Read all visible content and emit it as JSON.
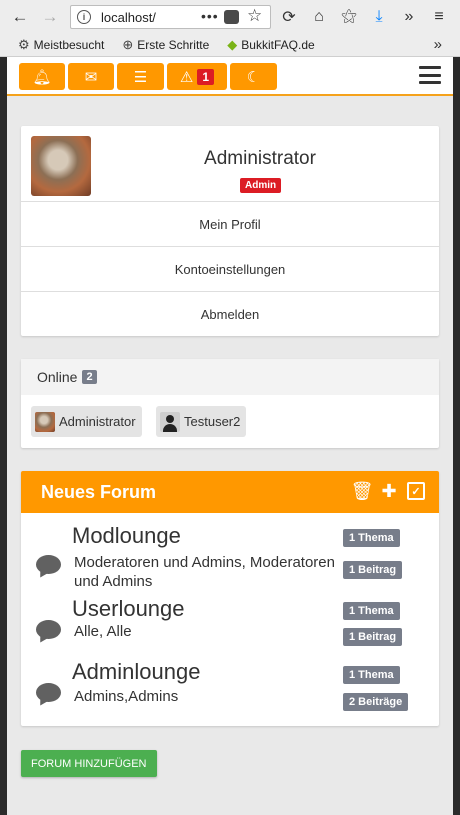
{
  "browser": {
    "url": "localhost/",
    "back_icon": "arrow-left",
    "forward_icon": "arrow-right",
    "reload_icon": "reload",
    "home_icon": "home",
    "bookmarks": [
      {
        "label": "Meistbesucht",
        "icon": "gear-icon"
      },
      {
        "label": "Erste Schritte",
        "icon": "globe-icon"
      },
      {
        "label": "BukkitFAQ.de",
        "icon": "bukkit-icon"
      }
    ],
    "more_label": "»"
  },
  "topnav": {
    "alert_count": "1",
    "accent": "#ff9800"
  },
  "profile": {
    "name": "Administrator",
    "role": "Admin",
    "menu": [
      "Mein Profil",
      "Kontoeinstellungen",
      "Abmelden"
    ]
  },
  "online": {
    "label": "Online",
    "count": "2",
    "users": [
      "Administrator",
      "Testuser2"
    ]
  },
  "forum": {
    "title": "Neues Forum",
    "rows": [
      {
        "title": "Modlounge",
        "desc": "Moderatoren und Admins, Moderatoren und Admins",
        "threads": "1 Thema",
        "posts": "1 Beitrag"
      },
      {
        "title": "Userlounge",
        "desc": "Alle, Alle",
        "threads": "1 Thema",
        "posts": "1 Beitrag"
      },
      {
        "title": "Adminlounge",
        "desc": "Admins,Admins",
        "threads": "1 Thema",
        "posts": "2 Beiträge"
      }
    ]
  },
  "add_forum_label": "Forum hinzufügen",
  "colors": {
    "orange": "#ff9800",
    "danger": "#dc1c24",
    "badge": "#777d8a",
    "success": "#4caf50"
  }
}
